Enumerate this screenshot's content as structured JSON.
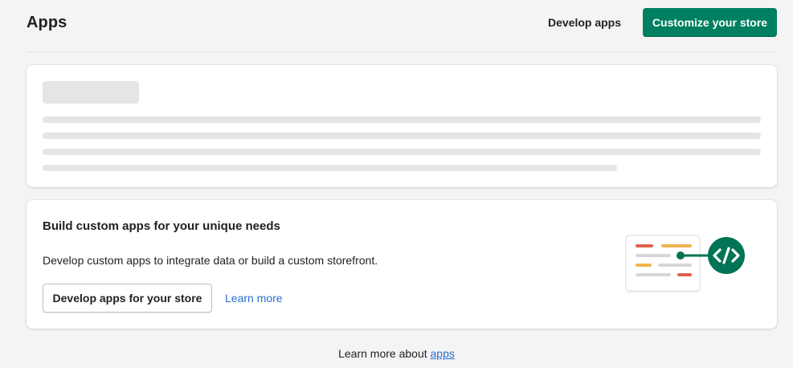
{
  "header": {
    "title": "Apps",
    "develop_apps_label": "Develop apps",
    "customize_label": "Customize your store"
  },
  "build_card": {
    "title": "Build custom apps for your unique needs",
    "description": "Develop custom apps to integrate data or build a custom storefront.",
    "primary_button_label": "Develop apps for your store",
    "learn_more_label": "Learn more",
    "illustration_icon": "code-brackets-icon"
  },
  "footer": {
    "prefix": "Learn more about ",
    "link_label": "apps"
  },
  "colors": {
    "primary": "#008060",
    "link": "#2c6ecb",
    "skeleton": "#e4e5e7",
    "background": "#f4f4f5"
  }
}
